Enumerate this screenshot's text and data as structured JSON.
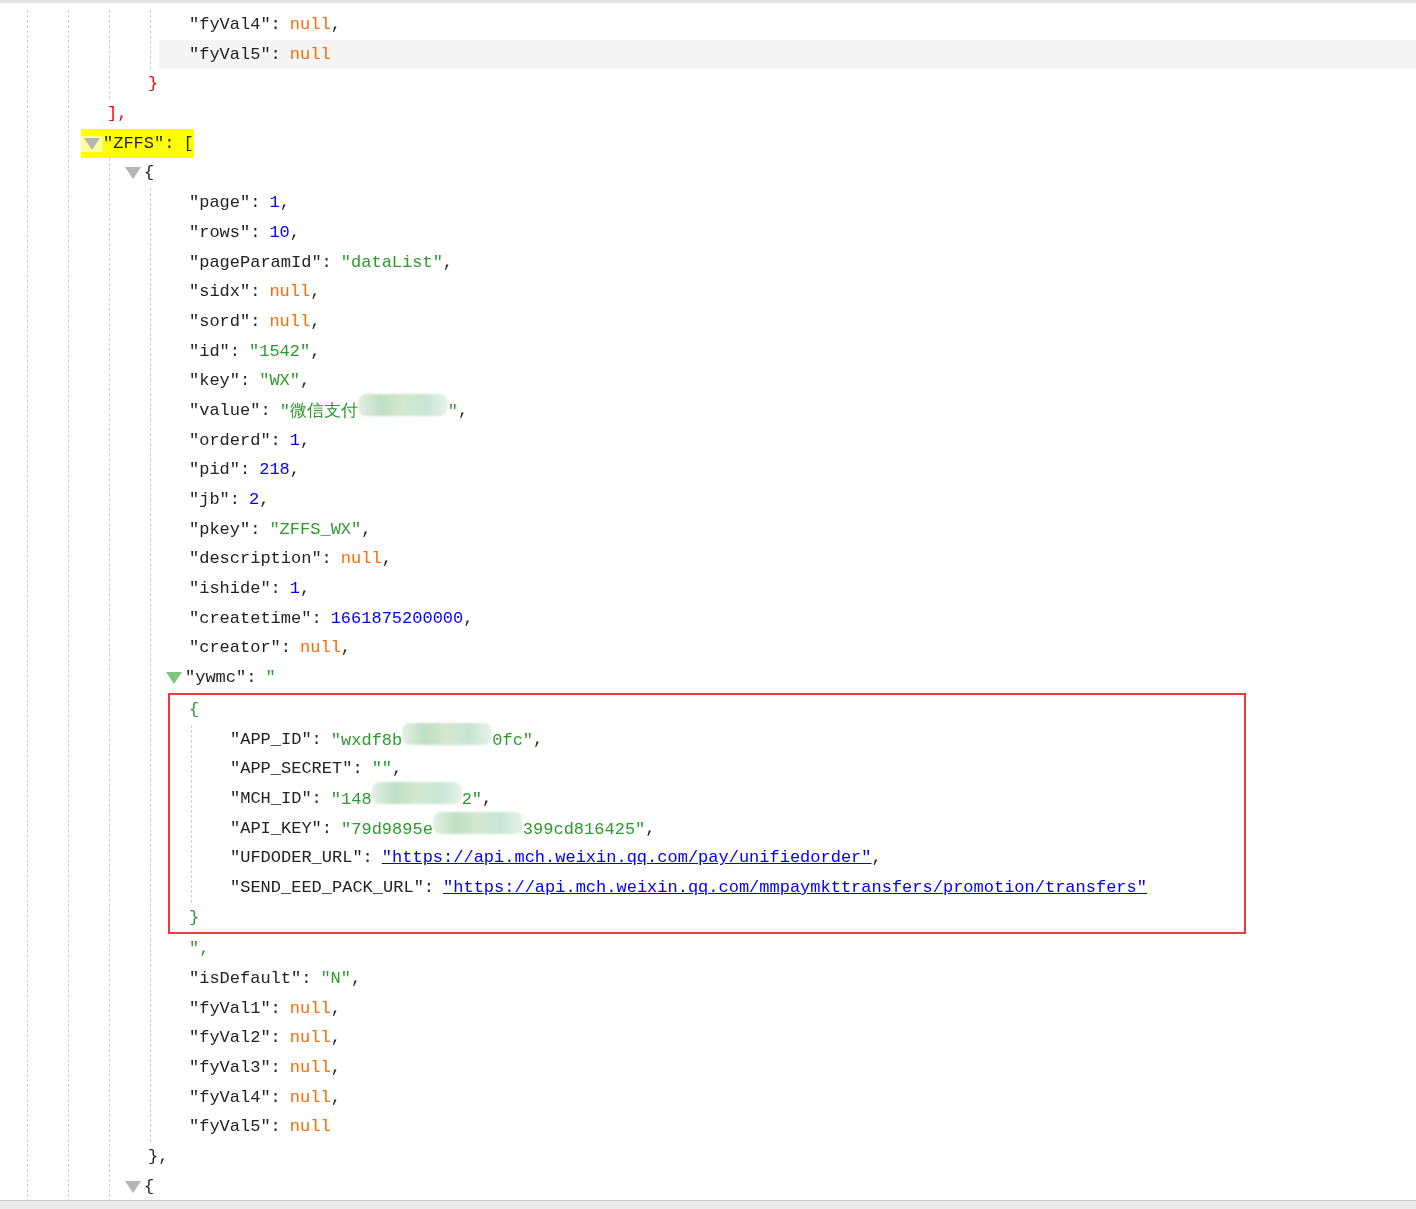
{
  "tree": [
    {
      "kind": "block",
      "bracket_highlight": true,
      "children": [
        {
          "kind": "block",
          "bracket_highlight": true,
          "children": [
            {
              "kind": "null",
              "key": "\"fyVal4\":",
              "value": "null",
              "punct": ","
            },
            {
              "kind": "null",
              "key": "\"fyVal5\":",
              "value": "null",
              "hovered": true
            }
          ],
          "close": "}"
        }
      ],
      "close": "],"
    },
    {
      "kind": "block",
      "key": "\"ZFFS\":",
      "open": "[",
      "expanded": true,
      "highlighted": true,
      "children": [
        {
          "kind": "block",
          "open": "{",
          "expanded": true,
          "children": [
            {
              "kind": "number",
              "key": "\"page\":",
              "value": "1",
              "punct": ","
            },
            {
              "kind": "number",
              "key": "\"rows\":",
              "value": "10",
              "punct": ","
            },
            {
              "kind": "string",
              "key": "\"pageParamId\":",
              "value": "\"dataList\"",
              "punct": ","
            },
            {
              "kind": "null",
              "key": "\"sidx\":",
              "value": "null",
              "punct": ","
            },
            {
              "kind": "null",
              "key": "\"sord\":",
              "value": "null",
              "punct": ","
            },
            {
              "kind": "string",
              "key": "\"id\":",
              "value": "\"1542\"",
              "punct": ","
            },
            {
              "kind": "string",
              "key": "\"key\":",
              "value": "\"WX\"",
              "punct": ","
            },
            {
              "kind": "string",
              "key": "\"value\":",
              "value": [
                {
                  "kind": "text",
                  "text": "\"微信支付"
                },
                {
                  "kind": "redacted"
                },
                {
                  "kind": "text",
                  "text": "\""
                }
              ],
              "punct": ","
            },
            {
              "kind": "number",
              "key": "\"orderd\":",
              "value": "1",
              "punct": ","
            },
            {
              "kind": "number",
              "key": "\"pid\":",
              "value": "218",
              "punct": ","
            },
            {
              "kind": "number",
              "key": "\"jb\":",
              "value": "2",
              "punct": ","
            },
            {
              "kind": "string",
              "key": "\"pkey\":",
              "value": "\"ZFFS_WX\"",
              "punct": ","
            },
            {
              "kind": "null",
              "key": "\"description\":",
              "value": "null",
              "punct": ","
            },
            {
              "kind": "number",
              "key": "\"ishide\":",
              "value": "1",
              "punct": ","
            },
            {
              "kind": "number",
              "key": "\"createtime\":",
              "value": "1661875200000",
              "punct": ","
            },
            {
              "kind": "null",
              "key": "\"creator\":",
              "value": "null",
              "punct": ","
            },
            {
              "kind": "embedded",
              "key": "\"ywmc\":",
              "open_quote": "\"",
              "expanded": true,
              "outlined": true,
              "open": "{",
              "children": [
                {
                  "kind": "string",
                  "key": "\"APP_ID\":",
                  "value": [
                    {
                      "kind": "text",
                      "text": "\"wxdf8b"
                    },
                    {
                      "kind": "redacted"
                    },
                    {
                      "kind": "text",
                      "text": "0fc\""
                    }
                  ],
                  "punct": ","
                },
                {
                  "kind": "string",
                  "key": "\"APP_SECRET\":",
                  "value": "\"\"",
                  "punct": ","
                },
                {
                  "kind": "string",
                  "key": "\"MCH_ID\":",
                  "value": [
                    {
                      "kind": "text",
                      "text": "\"148"
                    },
                    {
                      "kind": "redacted"
                    },
                    {
                      "kind": "text",
                      "text": "2\""
                    }
                  ],
                  "punct": ","
                },
                {
                  "kind": "string",
                  "key": "\"API_KEY\":",
                  "value": [
                    {
                      "kind": "text",
                      "text": "\"79d9895e"
                    },
                    {
                      "kind": "redacted"
                    },
                    {
                      "kind": "text",
                      "text": "399cd816425\""
                    }
                  ],
                  "punct": ","
                },
                {
                  "kind": "link",
                  "key": "\"UFDODER_URL\":",
                  "value": "\"https://api.mch.weixin.qq.com/pay/unifiedorder\"",
                  "punct": ","
                },
                {
                  "kind": "link",
                  "key": "\"SEND_EED_PACK_URL\":",
                  "value": "\"https://api.mch.weixin.qq.com/mmpaymkttransfers/promotion/transfers\""
                }
              ],
              "close": "}",
              "tail": "\","
            },
            {
              "kind": "string",
              "key": "\"isDefault\":",
              "value": "\"N\"",
              "punct": ","
            },
            {
              "kind": "null",
              "key": "\"fyVal1\":",
              "value": "null",
              "punct": ","
            },
            {
              "kind": "null",
              "key": "\"fyVal2\":",
              "value": "null",
              "punct": ","
            },
            {
              "kind": "null",
              "key": "\"fyVal3\":",
              "value": "null",
              "punct": ","
            },
            {
              "kind": "null",
              "key": "\"fyVal4\":",
              "value": "null",
              "punct": ","
            },
            {
              "kind": "null",
              "key": "\"fyVal5\":",
              "value": "null"
            }
          ],
          "close": "},"
        },
        {
          "kind": "block",
          "open": "{",
          "expanded": true
        }
      ]
    }
  ]
}
